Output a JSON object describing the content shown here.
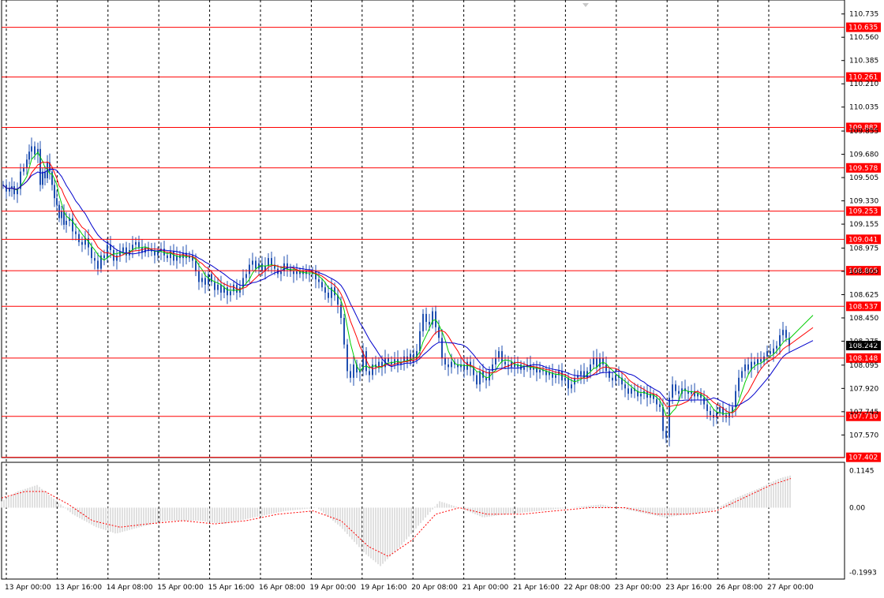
{
  "chart_data": {
    "type": "candlestick",
    "instrument_hint": "",
    "colors": {
      "background": "#ffffff",
      "grid": "#000000",
      "candle": "#1f4fb0",
      "level_line": "#ff0000",
      "level_label_bg": "#ff0000",
      "level_label_text": "#ffffff",
      "current_label_bg": "#000000",
      "ma_fast": "#00cc00",
      "ma_mid": "#ff0000",
      "ma_slow": "#0000cc",
      "histogram": "#c0c0c0",
      "signal": "#ff0000",
      "axis_text": "#000000"
    },
    "price_range": [
      107.4,
      110.84
    ],
    "price_ticks": [
      "110.735",
      "110.560",
      "110.385",
      "110.210",
      "110.035",
      "109.855",
      "109.680",
      "109.505",
      "109.330",
      "109.155",
      "108.975",
      "108.800",
      "108.625",
      "108.450",
      "108.275",
      "108.095",
      "107.920",
      "107.745",
      "107.570"
    ],
    "levels": [
      "110.635",
      "110.261",
      "109.882",
      "109.578",
      "109.253",
      "109.041",
      "108.805",
      "108.537",
      "108.148",
      "107.710",
      "107.402"
    ],
    "current_price": "108.242",
    "time_labels": [
      "13 Apr 00:00",
      "13 Apr 16:00",
      "14 Apr 08:00",
      "15 Apr 00:00",
      "15 Apr 16:00",
      "16 Apr 08:00",
      "19 Apr 00:00",
      "19 Apr 16:00",
      "20 Apr 08:00",
      "21 Apr 00:00",
      "21 Apr 16:00",
      "22 Apr 08:00",
      "23 Apr 00:00",
      "23 Apr 16:00",
      "26 Apr 08:00",
      "27 Apr 00:00"
    ],
    "close_path": [
      [
        0,
        109.45
      ],
      [
        4,
        109.4
      ],
      [
        8,
        109.42
      ],
      [
        11,
        109.44
      ],
      [
        14,
        109.38
      ],
      [
        18,
        109.42
      ],
      [
        22,
        109.55
      ],
      [
        26,
        109.58
      ],
      [
        30,
        109.64
      ],
      [
        33,
        109.7
      ],
      [
        36,
        109.74
      ],
      [
        40,
        109.68
      ],
      [
        44,
        109.72
      ],
      [
        47,
        109.45
      ],
      [
        50,
        109.55
      ],
      [
        53,
        109.5
      ],
      [
        56,
        109.62
      ],
      [
        59,
        109.55
      ],
      [
        62,
        109.45
      ],
      [
        65,
        109.35
      ],
      [
        68,
        109.3
      ],
      [
        71,
        109.2
      ],
      [
        74,
        109.25
      ],
      [
        77,
        109.15
      ],
      [
        80,
        109.18
      ],
      [
        84,
        109.2
      ],
      [
        88,
        109.1
      ],
      [
        92,
        109.08
      ],
      [
        96,
        109.02
      ],
      [
        100,
        109.0
      ],
      [
        104,
        109.05
      ],
      [
        108,
        108.98
      ],
      [
        112,
        108.9
      ],
      [
        116,
        108.88
      ],
      [
        120,
        108.82
      ],
      [
        124,
        108.92
      ],
      [
        128,
        108.9
      ],
      [
        132,
        109.0
      ],
      [
        136,
        108.96
      ],
      [
        140,
        108.88
      ],
      [
        144,
        108.92
      ],
      [
        148,
        108.95
      ],
      [
        152,
        108.98
      ],
      [
        156,
        108.92
      ],
      [
        160,
        108.96
      ],
      [
        164,
        109.0
      ],
      [
        168,
        109.02
      ],
      [
        172,
        108.98
      ],
      [
        176,
        108.94
      ],
      [
        180,
        108.98
      ],
      [
        184,
        108.96
      ],
      [
        188,
        108.95
      ],
      [
        192,
        108.92
      ],
      [
        196,
        108.95
      ],
      [
        200,
        108.97
      ],
      [
        204,
        108.92
      ],
      [
        208,
        108.9
      ],
      [
        212,
        108.95
      ],
      [
        216,
        108.88
      ],
      [
        220,
        108.92
      ],
      [
        224,
        108.9
      ],
      [
        228,
        108.94
      ],
      [
        232,
        108.9
      ],
      [
        236,
        108.92
      ],
      [
        240,
        108.88
      ],
      [
        244,
        108.8
      ],
      [
        248,
        108.72
      ],
      [
        252,
        108.75
      ],
      [
        256,
        108.7
      ],
      [
        260,
        108.78
      ],
      [
        264,
        108.72
      ],
      [
        268,
        108.66
      ],
      [
        272,
        108.7
      ],
      [
        276,
        108.64
      ],
      [
        280,
        108.68
      ],
      [
        284,
        108.62
      ],
      [
        288,
        108.65
      ],
      [
        292,
        108.7
      ],
      [
        296,
        108.64
      ],
      [
        300,
        108.68
      ],
      [
        304,
        108.75
      ],
      [
        308,
        108.78
      ],
      [
        312,
        108.85
      ],
      [
        316,
        108.88
      ],
      [
        320,
        108.82
      ],
      [
        324,
        108.86
      ],
      [
        328,
        108.8
      ],
      [
        332,
        108.84
      ],
      [
        336,
        108.9
      ],
      [
        340,
        108.85
      ],
      [
        344,
        108.82
      ],
      [
        348,
        108.78
      ],
      [
        352,
        108.8
      ],
      [
        356,
        108.86
      ],
      [
        360,
        108.82
      ],
      [
        364,
        108.8
      ],
      [
        368,
        108.78
      ],
      [
        372,
        108.8
      ],
      [
        376,
        108.78
      ],
      [
        380,
        108.8
      ],
      [
        384,
        108.78
      ],
      [
        388,
        108.78
      ],
      [
        392,
        108.8
      ],
      [
        396,
        108.74
      ],
      [
        400,
        108.72
      ],
      [
        404,
        108.68
      ],
      [
        408,
        108.64
      ],
      [
        412,
        108.6
      ],
      [
        416,
        108.68
      ],
      [
        420,
        108.62
      ],
      [
        424,
        108.55
      ],
      [
        428,
        108.45
      ],
      [
        432,
        108.25
      ],
      [
        436,
        108.05
      ],
      [
        440,
        108.0
      ],
      [
        444,
        108.1
      ],
      [
        448,
        108.04
      ],
      [
        452,
        108.06
      ],
      [
        456,
        108.2
      ],
      [
        460,
        108.05
      ],
      [
        464,
        108.02
      ],
      [
        468,
        108.1
      ],
      [
        472,
        108.08
      ],
      [
        476,
        108.12
      ],
      [
        480,
        108.08
      ],
      [
        484,
        108.15
      ],
      [
        488,
        108.12
      ],
      [
        492,
        108.1
      ],
      [
        496,
        108.14
      ],
      [
        500,
        108.1
      ],
      [
        504,
        108.12
      ],
      [
        508,
        108.16
      ],
      [
        512,
        108.12
      ],
      [
        516,
        108.18
      ],
      [
        520,
        108.14
      ],
      [
        524,
        108.2
      ],
      [
        528,
        108.35
      ],
      [
        532,
        108.48
      ],
      [
        536,
        108.42
      ],
      [
        540,
        108.4
      ],
      [
        544,
        108.5
      ],
      [
        548,
        108.38
      ],
      [
        552,
        108.3
      ],
      [
        556,
        108.15
      ],
      [
        560,
        108.1
      ],
      [
        564,
        108.08
      ],
      [
        568,
        108.12
      ],
      [
        572,
        108.1
      ],
      [
        576,
        108.08
      ],
      [
        580,
        108.1
      ],
      [
        584,
        108.06
      ],
      [
        588,
        108.12
      ],
      [
        592,
        108.08
      ],
      [
        596,
        108.02
      ],
      [
        600,
        107.95
      ],
      [
        604,
        108.05
      ],
      [
        608,
        108.0
      ],
      [
        612,
        107.98
      ],
      [
        616,
        108.05
      ],
      [
        620,
        108.1
      ],
      [
        624,
        108.15
      ],
      [
        628,
        108.2
      ],
      [
        632,
        108.12
      ],
      [
        636,
        108.1
      ],
      [
        640,
        108.08
      ],
      [
        644,
        108.12
      ],
      [
        648,
        108.08
      ],
      [
        652,
        108.1
      ],
      [
        656,
        108.06
      ],
      [
        660,
        108.08
      ],
      [
        664,
        108.1
      ],
      [
        668,
        108.06
      ],
      [
        672,
        108.08
      ],
      [
        676,
        108.04
      ],
      [
        680,
        108.06
      ],
      [
        684,
        108.05
      ],
      [
        688,
        108.02
      ],
      [
        692,
        108.04
      ],
      [
        696,
        108.0
      ],
      [
        700,
        108.02
      ],
      [
        704,
        108.05
      ],
      [
        708,
        107.98
      ],
      [
        712,
        108.0
      ],
      [
        716,
        107.92
      ],
      [
        720,
        107.95
      ],
      [
        724,
        108.0
      ],
      [
        728,
        108.02
      ],
      [
        732,
        108.05
      ],
      [
        736,
        108.0
      ],
      [
        740,
        108.05
      ],
      [
        744,
        108.1
      ],
      [
        748,
        108.15
      ],
      [
        752,
        108.08
      ],
      [
        756,
        108.15
      ],
      [
        760,
        108.1
      ],
      [
        764,
        108.05
      ],
      [
        768,
        108.0
      ],
      [
        772,
        107.98
      ],
      [
        776,
        108.02
      ],
      [
        780,
        108.0
      ],
      [
        784,
        107.95
      ],
      [
        788,
        107.92
      ],
      [
        792,
        107.88
      ],
      [
        796,
        107.92
      ],
      [
        800,
        107.9
      ],
      [
        804,
        107.86
      ],
      [
        808,
        107.88
      ],
      [
        812,
        107.9
      ],
      [
        816,
        107.85
      ],
      [
        820,
        107.88
      ],
      [
        824,
        107.84
      ],
      [
        828,
        107.8
      ],
      [
        832,
        107.78
      ],
      [
        836,
        107.6
      ],
      [
        840,
        107.55
      ],
      [
        844,
        107.85
      ],
      [
        848,
        107.95
      ],
      [
        852,
        107.9
      ],
      [
        856,
        107.88
      ],
      [
        860,
        107.92
      ],
      [
        864,
        107.9
      ],
      [
        868,
        107.88
      ],
      [
        872,
        107.9
      ],
      [
        876,
        107.86
      ],
      [
        880,
        107.88
      ],
      [
        884,
        107.85
      ],
      [
        888,
        107.8
      ],
      [
        892,
        107.75
      ],
      [
        896,
        107.72
      ],
      [
        900,
        107.7
      ],
      [
        904,
        107.74
      ],
      [
        908,
        107.78
      ],
      [
        912,
        107.72
      ],
      [
        916,
        107.7
      ],
      [
        920,
        107.74
      ],
      [
        924,
        107.78
      ],
      [
        928,
        107.9
      ],
      [
        932,
        108.0
      ],
      [
        936,
        108.05
      ],
      [
        940,
        108.1
      ],
      [
        944,
        108.06
      ],
      [
        948,
        108.12
      ],
      [
        952,
        108.1
      ],
      [
        956,
        108.14
      ],
      [
        960,
        108.12
      ],
      [
        964,
        108.16
      ],
      [
        968,
        108.2
      ],
      [
        972,
        108.18
      ],
      [
        976,
        108.22
      ],
      [
        980,
        108.24
      ],
      [
        984,
        108.32
      ],
      [
        988,
        108.36
      ],
      [
        992,
        108.3
      ],
      [
        996,
        108.24
      ]
    ],
    "oscillator": {
      "ticks": [
        "0.1145",
        "0.00",
        "-0.1993"
      ],
      "range": [
        -0.22,
        0.14
      ],
      "hist_path": [
        [
          0,
          0.02
        ],
        [
          20,
          0.05
        ],
        [
          45,
          0.07
        ],
        [
          60,
          0.04
        ],
        [
          90,
          -0.02
        ],
        [
          120,
          -0.06
        ],
        [
          145,
          -0.08
        ],
        [
          175,
          -0.06
        ],
        [
          210,
          -0.04
        ],
        [
          250,
          -0.04
        ],
        [
          280,
          -0.05
        ],
        [
          320,
          -0.03
        ],
        [
          360,
          -0.01
        ],
        [
          400,
          0.0
        ],
        [
          430,
          -0.06
        ],
        [
          460,
          -0.14
        ],
        [
          480,
          -0.18
        ],
        [
          505,
          -0.12
        ],
        [
          530,
          -0.05
        ],
        [
          555,
          0.02
        ],
        [
          580,
          0.0
        ],
        [
          610,
          -0.03
        ],
        [
          640,
          -0.02
        ],
        [
          680,
          -0.01
        ],
        [
          720,
          0.0
        ],
        [
          760,
          0.01
        ],
        [
          800,
          -0.01
        ],
        [
          840,
          -0.03
        ],
        [
          870,
          -0.02
        ],
        [
          900,
          -0.01
        ],
        [
          930,
          0.03
        ],
        [
          960,
          0.06
        ],
        [
          985,
          0.09
        ],
        [
          1000,
          0.1
        ]
      ],
      "signal_path": [
        [
          0,
          0.03
        ],
        [
          30,
          0.05
        ],
        [
          55,
          0.05
        ],
        [
          85,
          0.01
        ],
        [
          115,
          -0.04
        ],
        [
          150,
          -0.06
        ],
        [
          185,
          -0.05
        ],
        [
          230,
          -0.04
        ],
        [
          270,
          -0.05
        ],
        [
          310,
          -0.04
        ],
        [
          350,
          -0.02
        ],
        [
          395,
          -0.01
        ],
        [
          430,
          -0.04
        ],
        [
          465,
          -0.12
        ],
        [
          490,
          -0.15
        ],
        [
          520,
          -0.1
        ],
        [
          550,
          -0.02
        ],
        [
          580,
          0.0
        ],
        [
          615,
          -0.02
        ],
        [
          660,
          -0.02
        ],
        [
          700,
          -0.01
        ],
        [
          745,
          0.0
        ],
        [
          790,
          0.0
        ],
        [
          830,
          -0.02
        ],
        [
          870,
          -0.02
        ],
        [
          905,
          -0.01
        ],
        [
          940,
          0.03
        ],
        [
          975,
          0.07
        ],
        [
          1000,
          0.09
        ]
      ]
    }
  }
}
